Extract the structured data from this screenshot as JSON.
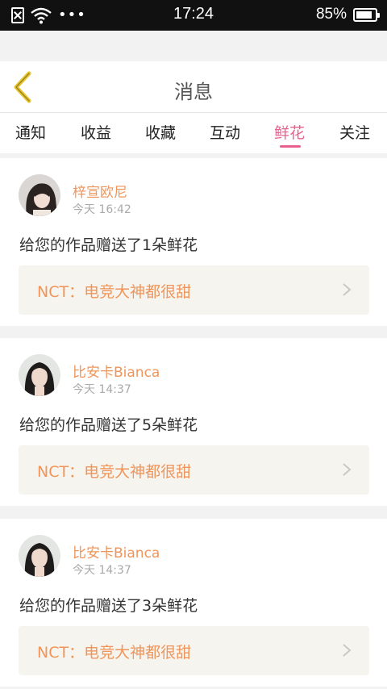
{
  "status_bar": {
    "time": "17:24",
    "battery_percent": "85%",
    "battery_level": 0.85,
    "more_dots": "•••",
    "icons": [
      "sim-error-icon",
      "wifi-icon",
      "battery-icon"
    ]
  },
  "header": {
    "title": "消息",
    "back_icon": "chevron-left-icon"
  },
  "tabs": [
    {
      "label": "通知",
      "active": false
    },
    {
      "label": "收益",
      "active": false
    },
    {
      "label": "收藏",
      "active": false
    },
    {
      "label": "互动",
      "active": false
    },
    {
      "label": "鲜花",
      "active": true
    },
    {
      "label": "关注",
      "active": false
    }
  ],
  "colors": {
    "accent": "#e8618e",
    "name_orange": "#f0955a",
    "link_bg": "#f6f4ee"
  },
  "notifications": [
    {
      "username": "梓宣欧尼",
      "time": "今天 16:42",
      "message": "给您的作品赠送了1朵鲜花",
      "work_title": "NCT：电竞大神都很甜"
    },
    {
      "username": "比安卡Bianca",
      "time": "今天 14:37",
      "message": "给您的作品赠送了5朵鲜花",
      "work_title": "NCT：电竞大神都很甜"
    },
    {
      "username": "比安卡Bianca",
      "time": "今天 14:37",
      "message": "给您的作品赠送了3朵鲜花",
      "work_title": "NCT：电竞大神都很甜"
    }
  ]
}
